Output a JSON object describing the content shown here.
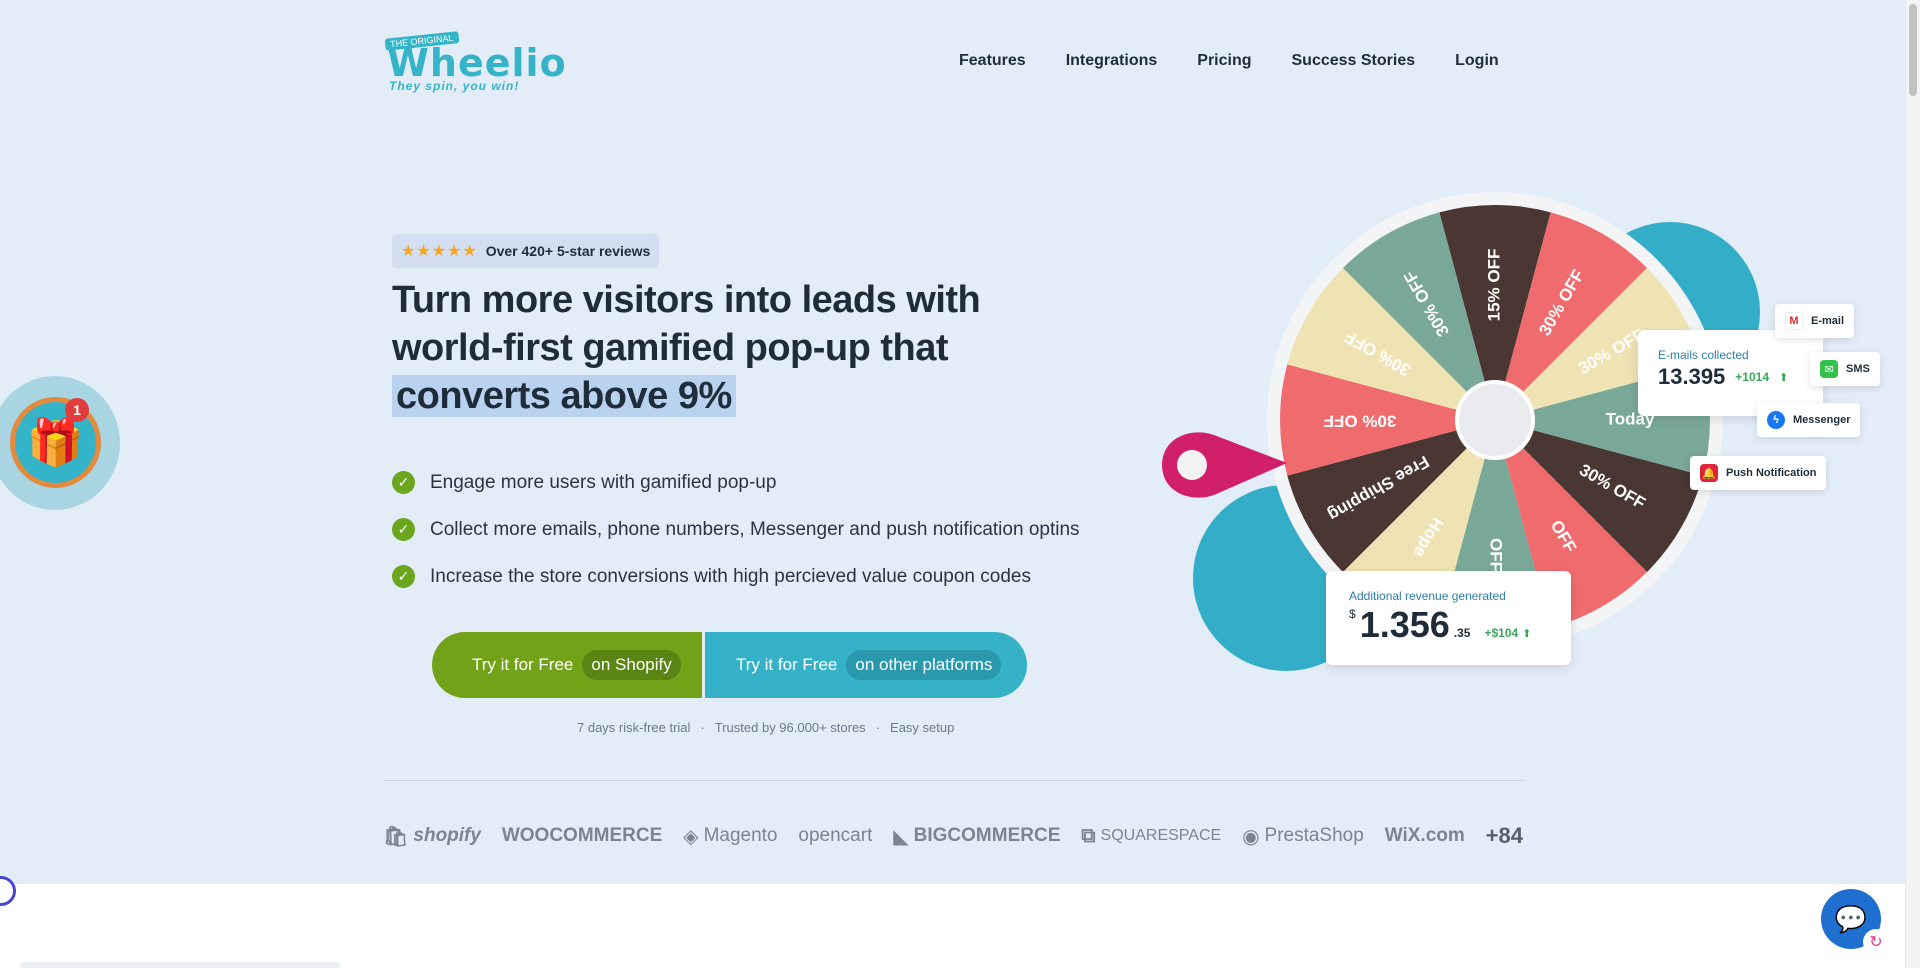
{
  "brand": {
    "logo_tag": "THE ORIGINAL",
    "logo_word": "Wheelio",
    "slogan": "They spin, you win!"
  },
  "nav": {
    "items": [
      {
        "label": "Features"
      },
      {
        "label": "Integrations"
      },
      {
        "label": "Pricing"
      },
      {
        "label": "Success Stories"
      },
      {
        "label": "Login"
      }
    ]
  },
  "hero": {
    "reviews_stars": "★★★★★",
    "reviews_text": "Over 420+ 5-star reviews",
    "headline_part1": "Turn more visitors into leads with world-first gamified pop-up that",
    "headline_highlight": "converts above 9%",
    "benefits": [
      "Engage more users with gamified pop-up",
      "Collect more emails, phone numbers, Messenger and push notification optins",
      "Increase the store conversions with high percieved value coupon codes"
    ],
    "cta_shopify": {
      "label": "Try it for Free",
      "pill": "on Shopify"
    },
    "cta_other": {
      "label": "Try it for Free",
      "pill": "on other platforms"
    },
    "trust": [
      "7 days risk-free trial",
      "·",
      "Trusted by 96.000+ stores",
      "·",
      "Easy setup"
    ]
  },
  "wheel": {
    "segments": [
      "15% OFF",
      "30% OFF",
      "30% OFF",
      "Today",
      "30% OFF",
      "OFF",
      "OFF",
      "Hope",
      "Free Shipping",
      "30% OFF",
      "30% OFF",
      "30% OFF"
    ],
    "colors": {
      "dark": "#4a3632",
      "red": "#f06b6e",
      "cream": "#efe3b4",
      "teal": "#7aa898",
      "accent": "#34aec8",
      "pointer": "#d21f69"
    },
    "emails_card": {
      "label": "E-mails collected",
      "value": "13.395",
      "delta": "+1014"
    },
    "revenue_card": {
      "label": "Additional revenue generated",
      "currency": "$",
      "value": "1.356",
      "cents": ".35",
      "delta": "+$104"
    },
    "channels": [
      {
        "label": "E-mail",
        "icon": "gmail-icon"
      },
      {
        "label": "SMS",
        "icon": "sms-icon"
      },
      {
        "label": "Messenger",
        "icon": "messenger-icon"
      },
      {
        "label": "Push Notification",
        "icon": "bell-icon"
      }
    ]
  },
  "platforms": [
    "shopify",
    "WOOCOMMERCE",
    "Magento",
    "opencart",
    "BIGCOMMERCE",
    "SQUARESPACE",
    "PrestaShop",
    "WiX.com",
    "+84"
  ],
  "widgets": {
    "gift_badge": "1"
  }
}
